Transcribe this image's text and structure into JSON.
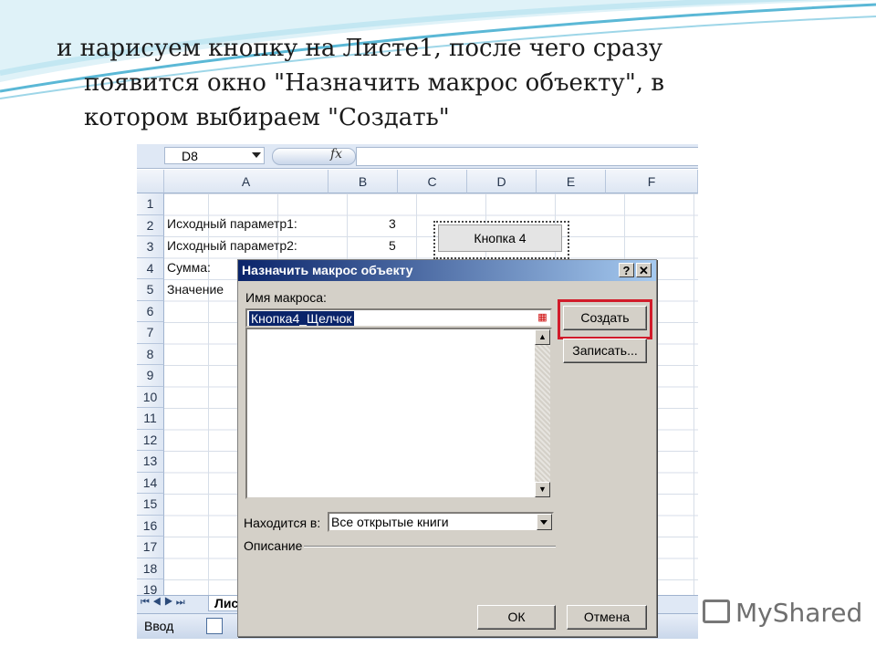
{
  "slide": {
    "line1": "и нарисуем кнопку на Листе1, после чего сразу",
    "line2": "появится окно \"Назначить макрос объекту\", в",
    "line3": "котором выбираем \"Создать\""
  },
  "excel": {
    "namebox": "D8",
    "fx": "fx",
    "columns": [
      "A",
      "B",
      "C",
      "D",
      "E",
      "F"
    ],
    "rows": [
      "1",
      "2",
      "3",
      "4",
      "5",
      "6",
      "7",
      "8",
      "9",
      "10",
      "11",
      "12",
      "13",
      "14",
      "15",
      "16",
      "17",
      "18",
      "19"
    ],
    "cells": {
      "a2": "Исходный параметр1:",
      "b2": "3",
      "a3": "Исходный параметр2:",
      "b3": "5",
      "a4": "Сумма:",
      "a5": "Значение"
    },
    "sheet_button": "Кнопка 4",
    "sheet_tab": "Лист",
    "status": "Ввод"
  },
  "dialog": {
    "title": "Назначить макрос объекту",
    "help_btn": "?",
    "close_btn": "✕",
    "macro_name_label": "Имя макроса:",
    "macro_name_value": "Кнопка4_Щелчок",
    "create_btn": "Создать",
    "record_btn": "Записать...",
    "located_label": "Находится в:",
    "located_value": "Все открытые книги",
    "description_label": "Описание",
    "ok_btn": "ОК",
    "cancel_btn": "Отмена"
  },
  "watermark": "MyShared",
  "colors": {
    "highlight": "#d11b2a",
    "title_bar": "#0a246a",
    "swoosh": "#5bb8d6"
  }
}
